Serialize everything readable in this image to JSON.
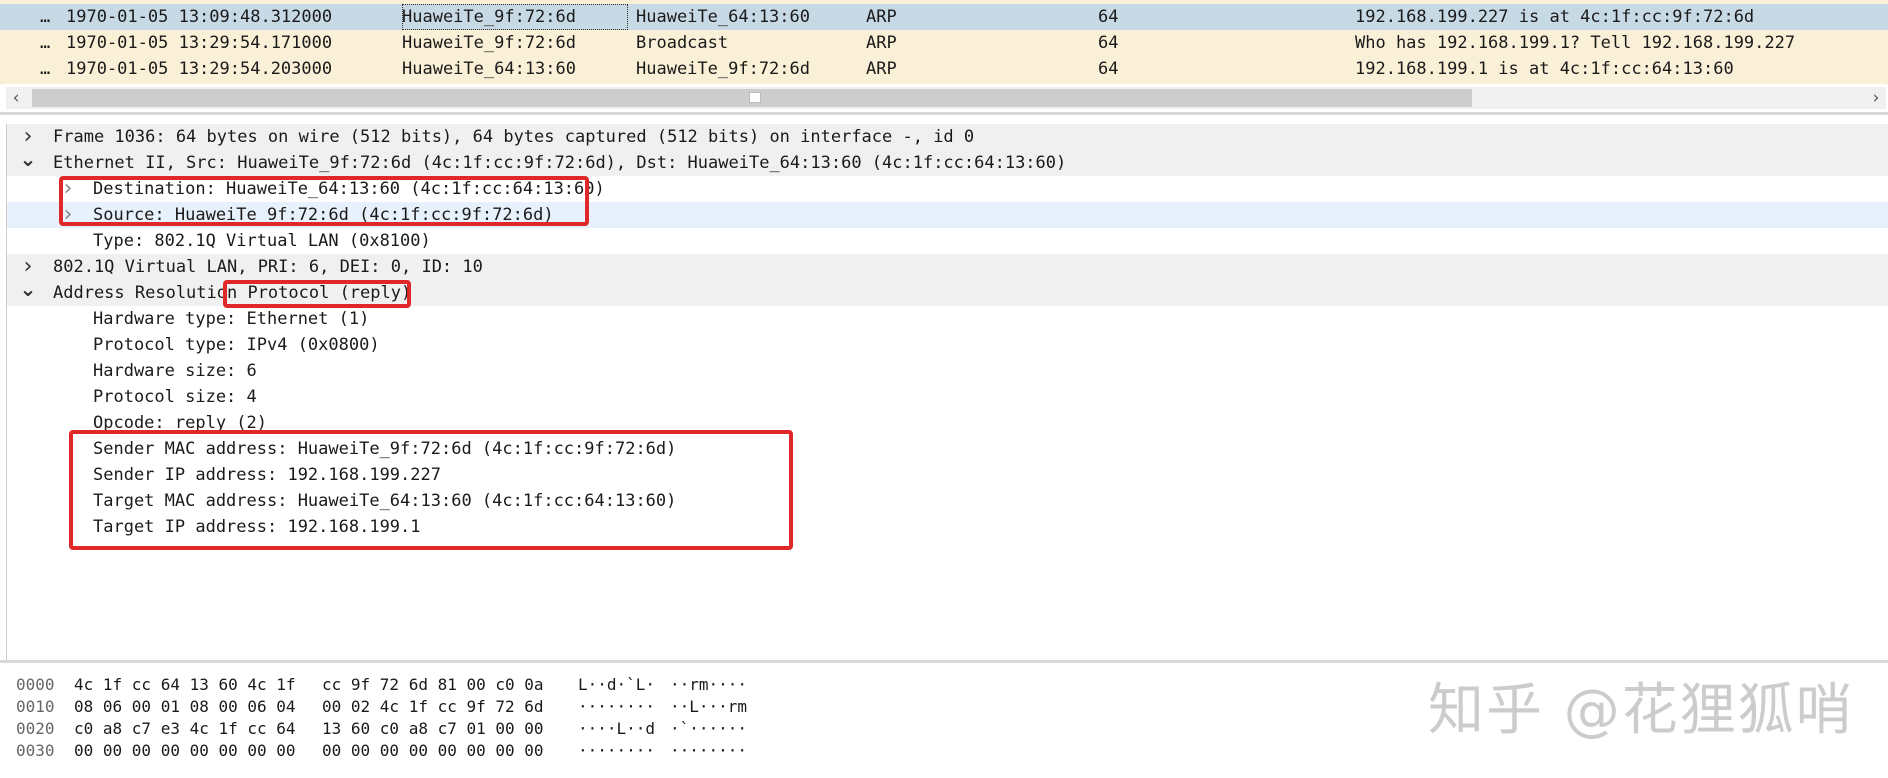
{
  "packet_list": {
    "rows": [
      {
        "no": "…",
        "time": "1970-01-05 13:09:48.312000",
        "source": "HuaweiTe_9f:72:6d",
        "destination": "HuaweiTe_64:13:60",
        "protocol": "ARP",
        "length": "64",
        "info": "192.168.199.227 is at 4c:1f:cc:9f:72:6d",
        "bg": "#c8d9e6",
        "selected": true
      },
      {
        "no": "…",
        "time": "1970-01-05 13:29:54.171000",
        "source": "HuaweiTe_9f:72:6d",
        "destination": "Broadcast",
        "protocol": "ARP",
        "length": "64",
        "info": "Who has 192.168.199.1? Tell 192.168.199.227",
        "bg": "#faf0d7",
        "selected": false
      },
      {
        "no": "…",
        "time": "1970-01-05 13:29:54.203000",
        "source": "HuaweiTe_64:13:60",
        "destination": "HuaweiTe_9f:72:6d",
        "protocol": "ARP",
        "length": "64",
        "info": "192.168.199.1 is at 4c:1f:cc:64:13:60",
        "bg": "#faf0d7",
        "selected": false
      }
    ],
    "scroll_left_icon": "chevron-left-icon",
    "scroll_right_icon": "chevron-right-icon"
  },
  "details": {
    "rows": [
      {
        "level": 0,
        "expanded": false,
        "text": "Frame 1036: 64 bytes on wire (512 bits), 64 bytes captured (512 bits) on interface -, id 0",
        "bg": "#f0f0f0"
      },
      {
        "level": 0,
        "expanded": true,
        "text": "Ethernet II, Src: HuaweiTe_9f:72:6d (4c:1f:cc:9f:72:6d), Dst: HuaweiTe_64:13:60 (4c:1f:cc:64:13:60)",
        "bg": "#f0f0f0"
      },
      {
        "level": 1,
        "expanded": false,
        "text": "Destination: HuaweiTe_64:13:60 (4c:1f:cc:64:13:60)",
        "bg": "#ffffff"
      },
      {
        "level": 1,
        "expanded": false,
        "text": "Source: HuaweiTe_9f:72:6d (4c:1f:cc:9f:72:6d)",
        "bg": "#e6f1fb"
      },
      {
        "level": 1,
        "leaf": true,
        "text": "Type: 802.1Q Virtual LAN (0x8100)",
        "bg": "#ffffff"
      },
      {
        "level": 0,
        "expanded": false,
        "text": "802.1Q Virtual LAN, PRI: 6, DEI: 0, ID: 10",
        "bg": "#f0f0f0"
      },
      {
        "level": 0,
        "expanded": true,
        "text": "Address Resolution Protocol (reply)",
        "bg": "#f0f0f0"
      },
      {
        "level": 1,
        "leaf": true,
        "text": "Hardware type: Ethernet (1)",
        "bg": "#ffffff"
      },
      {
        "level": 1,
        "leaf": true,
        "text": "Protocol type: IPv4 (0x0800)",
        "bg": "#ffffff"
      },
      {
        "level": 1,
        "leaf": true,
        "text": "Hardware size: 6",
        "bg": "#ffffff"
      },
      {
        "level": 1,
        "leaf": true,
        "text": "Protocol size: 4",
        "bg": "#ffffff"
      },
      {
        "level": 1,
        "leaf": true,
        "text": "Opcode: reply (2)",
        "bg": "#ffffff"
      },
      {
        "level": 1,
        "leaf": true,
        "text": "Sender MAC address: HuaweiTe_9f:72:6d (4c:1f:cc:9f:72:6d)",
        "bg": "#ffffff"
      },
      {
        "level": 1,
        "leaf": true,
        "text": "Sender IP address: 192.168.199.227",
        "bg": "#ffffff"
      },
      {
        "level": 1,
        "leaf": true,
        "text": "Target MAC address: HuaweiTe_64:13:60 (4c:1f:cc:64:13:60)",
        "bg": "#ffffff"
      },
      {
        "level": 1,
        "leaf": true,
        "text": "Target IP address: 192.168.199.1",
        "bg": "#ffffff"
      }
    ],
    "expand_icon": "chevron-right-icon",
    "collapse_icon": "chevron-down-icon",
    "highlight_color": "#e0282a"
  },
  "bytes": {
    "rows": [
      {
        "offset": "0000",
        "hex1": "4c 1f cc 64 13 60 4c 1f",
        "hex2": "cc 9f 72 6d 81 00 c0 0a",
        "ascii1": "L··d·`L·",
        "ascii2": "··rm····"
      },
      {
        "offset": "0010",
        "hex1": "08 06 00 01 08 00 06 04",
        "hex2": "00 02 4c 1f cc 9f 72 6d",
        "ascii1": "········",
        "ascii2": "··L···rm"
      },
      {
        "offset": "0020",
        "hex1": "c0 a8 c7 e3 4c 1f cc 64",
        "hex2": "13 60 c0 a8 c7 01 00 00",
        "ascii1": "····L··d",
        "ascii2": "·`······"
      },
      {
        "offset": "0030",
        "hex1": "00 00 00 00 00 00 00 00",
        "hex2": "00 00 00 00 00 00 00 00",
        "ascii1": "········",
        "ascii2": "········"
      }
    ]
  },
  "watermark": "知乎 @花狸狐哨"
}
